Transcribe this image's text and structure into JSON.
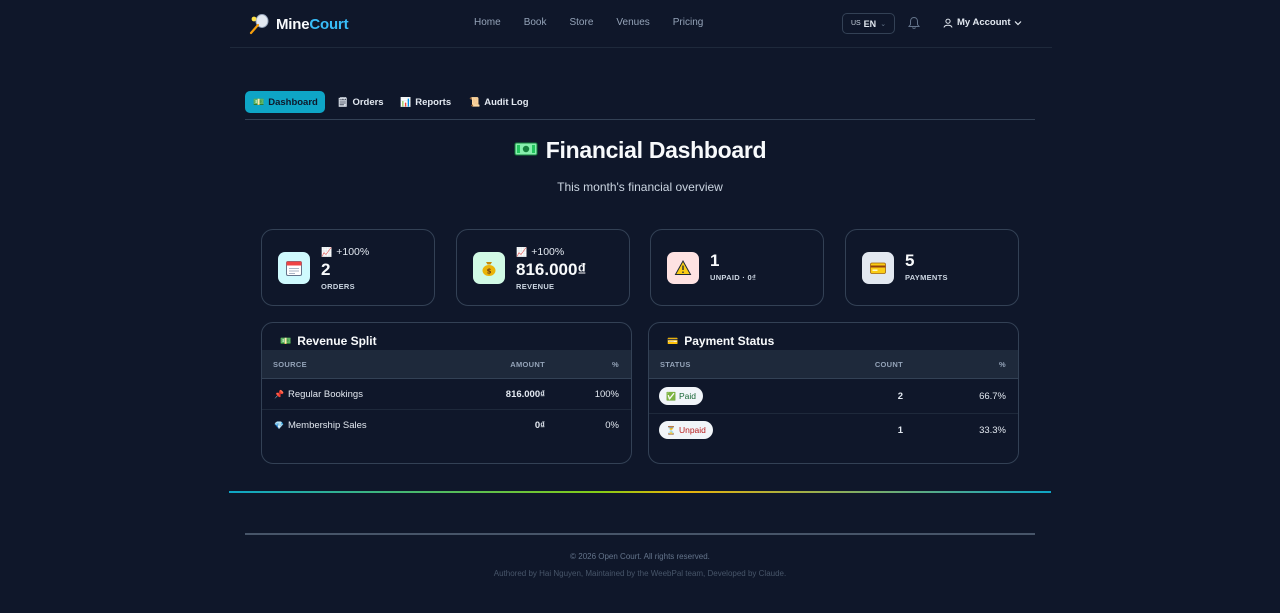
{
  "brand": {
    "mine": "Mine",
    "court": "Court"
  },
  "nav": {
    "items": [
      "Home",
      "Book",
      "Store",
      "Venues",
      "Pricing"
    ]
  },
  "header": {
    "lang_flag": "US",
    "lang_code": "EN",
    "account_label": "My Account"
  },
  "tabs": [
    {
      "label": "Dashboard",
      "icon": "💵"
    },
    {
      "label": "Orders",
      "icon": "🗒"
    },
    {
      "label": "Reports",
      "icon": "📊"
    },
    {
      "label": "Audit Log",
      "icon": "📜"
    }
  ],
  "page": {
    "title": "Financial Dashboard",
    "subtitle": "This month's financial overview"
  },
  "stats": [
    {
      "icon": "calendar-icon",
      "trend": "+100%",
      "value": "2",
      "label": "ORDERS"
    },
    {
      "icon": "money-bag-icon",
      "trend": "+100%",
      "value": "816.000₫",
      "label": "REVENUE"
    },
    {
      "icon": "warning-icon",
      "value": "1",
      "label": "UNPAID · 0₫"
    },
    {
      "icon": "credit-card-icon",
      "value": "5",
      "label": "PAYMENTS"
    }
  ],
  "revenue_split": {
    "title": "Revenue Split",
    "headers": [
      "SOURCE",
      "AMOUNT",
      "%"
    ],
    "rows": [
      {
        "icon": "📌",
        "source": "Regular Bookings",
        "amount": "816.000₫",
        "percent": "100%"
      },
      {
        "icon": "💎",
        "source": "Membership Sales",
        "amount": "0₫",
        "percent": "0%"
      }
    ]
  },
  "payment_status": {
    "title": "Payment Status",
    "headers": [
      "STATUS",
      "COUNT",
      "%"
    ],
    "rows": [
      {
        "icon": "✅",
        "status": "Paid",
        "count": "2",
        "percent": "66.7%"
      },
      {
        "icon": "⏳",
        "status": "Unpaid",
        "count": "1",
        "percent": "33.3%"
      }
    ]
  },
  "footer": {
    "copyright": "© 2026 Open Court. All rights reserved.",
    "credits": "Authored by Hai Nguyen, Maintained by the WeebPal team, Developed by Claude."
  },
  "colors": {
    "accent": "#0ea5c6",
    "background": "#0f172a",
    "brand_court": "#38bdf8"
  }
}
